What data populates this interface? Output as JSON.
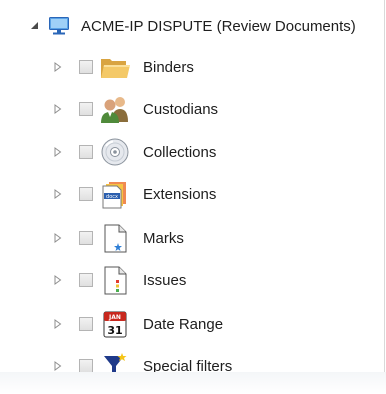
{
  "tree": {
    "root": {
      "label": "ACME-IP DISPUTE (Review Documents)",
      "icon": "computer-icon"
    },
    "items": [
      {
        "label": "Binders",
        "icon": "folder-icon"
      },
      {
        "label": "Custodians",
        "icon": "people-icon"
      },
      {
        "label": "Collections",
        "icon": "disc-icon"
      },
      {
        "label": "Extensions",
        "icon": "file-types-icon"
      },
      {
        "label": "Marks",
        "icon": "mark-document-icon"
      },
      {
        "label": "Issues",
        "icon": "issues-document-icon"
      },
      {
        "label": "Date Range",
        "icon": "calendar-icon"
      },
      {
        "label": "Special filters",
        "icon": "funnel-icon"
      }
    ]
  },
  "calendar_icon": {
    "month": "JAN",
    "day": "31"
  },
  "extensions_icon": {
    "text": "docx"
  },
  "colors": {
    "text": "#1e1e1e",
    "checkbox_border": "#b4b4b4",
    "expander": "#8f8f8f",
    "root_expander": "#4a4a4a"
  }
}
